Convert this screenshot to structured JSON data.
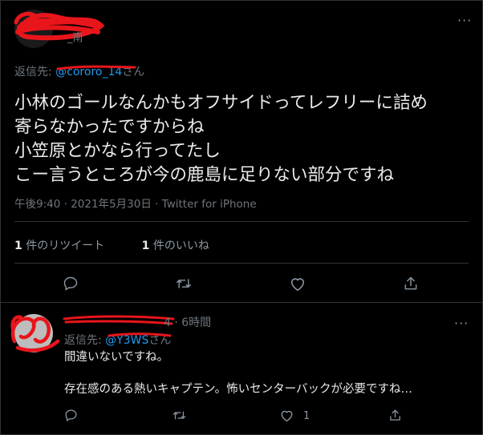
{
  "main_tweet": {
    "handle_tail": "_南",
    "reply_to": {
      "prefix": "返信先: ",
      "handle": "@cororo_14",
      "suffix": "さん"
    },
    "text": "小林のゴールなんかもオフサイドってレフリーに詰め\n寄らなかったですからね\n小笠原とかなら行ってたし\nこー言うところが今の鹿島に足りない部分ですね",
    "meta": "午後9:40 · 2021年5月30日 · Twitter for iPhone",
    "retweet_count": "1",
    "retweet_label": " 件のリツイート",
    "like_count": "1",
    "like_label": " 件のいいね",
    "more": "···"
  },
  "reply_tweet": {
    "header": "4 · 6時間",
    "reply_to": {
      "prefix": "返信先: ",
      "handle": "@Y3WS",
      "suffix": "さん"
    },
    "text": "間違いないですね。\n\n存在感のある熱いキャプテン。怖いセンターバックが必要ですね…",
    "like_count": "1",
    "more": "···"
  },
  "colors": {
    "background": "#000000",
    "text": "#e7e9ea",
    "secondary": "#6e767d",
    "link": "#1d9bf0",
    "redaction": "#e8151b"
  },
  "icons": [
    "reply-icon",
    "retweet-icon",
    "like-icon",
    "share-icon",
    "more-icon"
  ]
}
